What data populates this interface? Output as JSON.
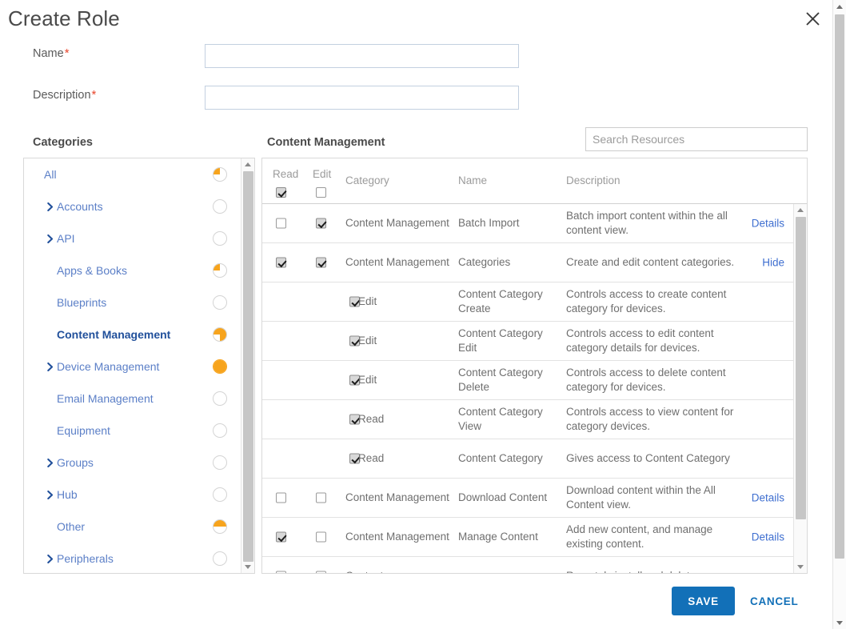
{
  "dialog": {
    "title": "Create Role",
    "close_icon": "close-icon"
  },
  "form": {
    "name": {
      "label": "Name",
      "required_mark": "*",
      "value": "",
      "placeholder": ""
    },
    "description": {
      "label": "Description",
      "required_mark": "*",
      "value": "",
      "placeholder": ""
    }
  },
  "sections": {
    "categories_heading": "Categories",
    "content_heading": "Content Management"
  },
  "search": {
    "placeholder": "Search Resources",
    "value": ""
  },
  "categories": [
    {
      "label": "All",
      "expandable": false,
      "indent": false,
      "selected": false,
      "fill": "q1"
    },
    {
      "label": "Accounts",
      "expandable": true,
      "indent": true,
      "selected": false,
      "fill": "none"
    },
    {
      "label": "API",
      "expandable": true,
      "indent": true,
      "selected": false,
      "fill": "none"
    },
    {
      "label": "Apps & Books",
      "expandable": false,
      "indent": true,
      "selected": false,
      "fill": "q1"
    },
    {
      "label": "Blueprints",
      "expandable": false,
      "indent": true,
      "selected": false,
      "fill": "none"
    },
    {
      "label": "Content Management",
      "expandable": false,
      "indent": true,
      "selected": true,
      "fill": "q3"
    },
    {
      "label": "Device Management",
      "expandable": true,
      "indent": true,
      "selected": false,
      "fill": "full"
    },
    {
      "label": "Email Management",
      "expandable": false,
      "indent": true,
      "selected": false,
      "fill": "none"
    },
    {
      "label": "Equipment",
      "expandable": false,
      "indent": true,
      "selected": false,
      "fill": "none"
    },
    {
      "label": "Groups",
      "expandable": true,
      "indent": true,
      "selected": false,
      "fill": "none"
    },
    {
      "label": "Hub",
      "expandable": true,
      "indent": true,
      "selected": false,
      "fill": "none"
    },
    {
      "label": "Other",
      "expandable": false,
      "indent": true,
      "selected": false,
      "fill": "half"
    },
    {
      "label": "Peripherals",
      "expandable": true,
      "indent": true,
      "selected": false,
      "fill": "none"
    }
  ],
  "table": {
    "columns": {
      "read": "Read",
      "edit": "Edit",
      "category": "Category",
      "name": "Name",
      "description": "Description"
    },
    "header_read_checked": true,
    "header_edit_checked": false,
    "rows": [
      {
        "kind": "main",
        "read": false,
        "edit": true,
        "category": "Content Management",
        "name": "Batch Import",
        "description": "Batch import content within the all content view.",
        "action": "Details"
      },
      {
        "kind": "main",
        "read": true,
        "edit": true,
        "category": "Content Management",
        "name": "Categories",
        "description": "Create and edit content categories.",
        "action": "Hide"
      },
      {
        "kind": "sub",
        "checked": true,
        "sublabel": "Edit",
        "name": "Content Category Create",
        "description": "Controls access to create content category for devices.",
        "action": ""
      },
      {
        "kind": "sub",
        "checked": true,
        "sublabel": "Edit",
        "name": "Content Category Edit",
        "description": "Controls access to edit content category details for devices.",
        "action": ""
      },
      {
        "kind": "sub",
        "checked": true,
        "sublabel": "Edit",
        "name": "Content Category Delete",
        "description": "Controls access to delete content category for devices.",
        "action": ""
      },
      {
        "kind": "sub",
        "checked": true,
        "sublabel": "Read",
        "name": "Content Category View",
        "description": "Controls access to view content for category devices.",
        "action": ""
      },
      {
        "kind": "sub",
        "checked": true,
        "sublabel": "Read",
        "name": "Content Category",
        "description": "Gives access to Content Category",
        "action": ""
      },
      {
        "kind": "main",
        "read": false,
        "edit": false,
        "category": "Content Management",
        "name": "Download Content",
        "description": "Download content within the All Content view.",
        "action": "Details"
      },
      {
        "kind": "main",
        "read": true,
        "edit": false,
        "category": "Content Management",
        "name": "Manage Content",
        "description": "Add new content, and manage existing content.",
        "action": "Details"
      },
      {
        "kind": "main",
        "read": false,
        "edit": false,
        "category": "Content",
        "name": "",
        "description": "Remotely install and delete",
        "action": ""
      }
    ]
  },
  "footer": {
    "save_label": "SAVE",
    "cancel_label": "CANCEL"
  },
  "colors": {
    "accent_blue": "#1270b8",
    "link_blue": "#3f6fd0",
    "category_blue": "#5b7fc7",
    "selected_blue": "#21509b",
    "orange": "#f7a41d",
    "required_red": "#e8462c"
  }
}
